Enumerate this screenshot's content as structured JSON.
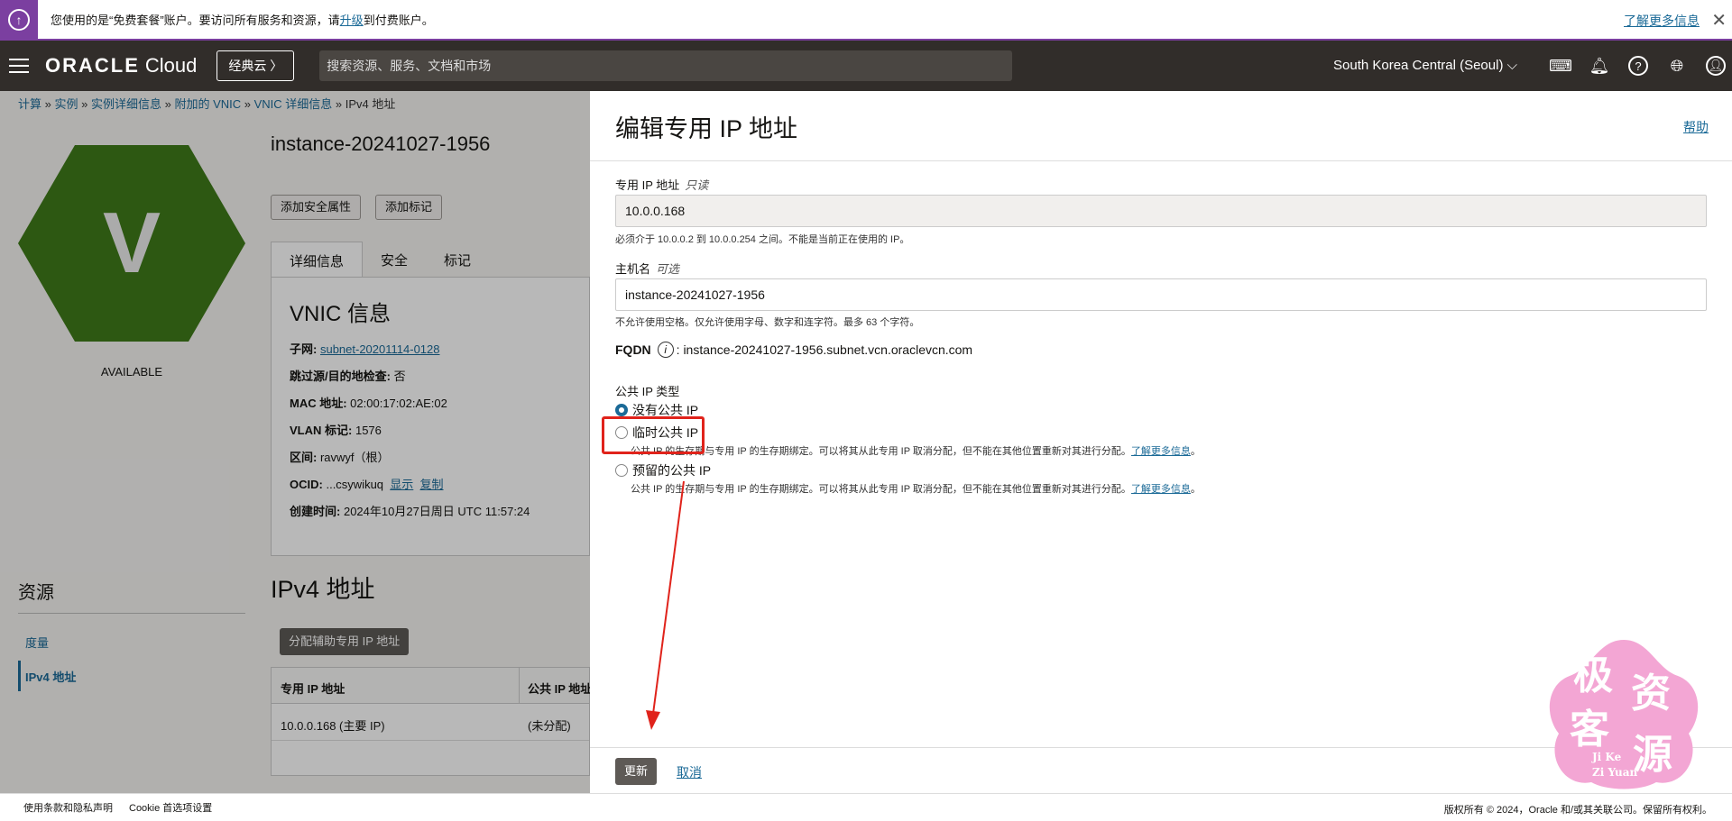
{
  "announcement": {
    "text_before": "您使用的是“免费套餐”账户。要访问所有服务和资源，请",
    "upgrade_link": "升级",
    "text_after": "到付费账户。",
    "learn_more": "了解更多信息"
  },
  "header": {
    "logo_oracle": "ORACLE",
    "logo_cloud": "Cloud",
    "classic_button": "经典云 〉",
    "search_placeholder": "搜索资源、服务、文档和市场",
    "region": "South Korea Central (Seoul)"
  },
  "breadcrumb": [
    "计算",
    "实例",
    "实例详细信息",
    "附加的 VNIC",
    "VNIC 详细信息",
    "IPv4 地址"
  ],
  "instance": {
    "badge_letter": "V",
    "status": "AVAILABLE",
    "name": "instance-20241027-1956",
    "btn_add_security": "添加安全属性",
    "btn_add_tags": "添加标记"
  },
  "tabs": [
    "详细信息",
    "安全",
    "标记"
  ],
  "vnic_info": {
    "title": "VNIC 信息",
    "subnet_label": "子网:",
    "subnet_value": "subnet-20201114-0128",
    "skip_check_label": "跳过源/目的地检查:",
    "skip_check_value": "否",
    "mac_label": "MAC 地址:",
    "mac_value": "02:00:17:02:AE:02",
    "vlan_label": "VLAN 标记:",
    "vlan_value": "1576",
    "zone_label": "区间:",
    "zone_value": "ravwyf（根）",
    "ocid_label": "OCID:",
    "ocid_value": "...csywikuq",
    "ocid_show": "显示",
    "ocid_copy": "复制",
    "created_label": "创建时间:",
    "created_value": "2024年10月27日周日 UTC 11:57:24"
  },
  "resources": {
    "title": "资源",
    "items": [
      "度量",
      "IPv4 地址"
    ]
  },
  "ipv4": {
    "title": "IPv4 地址",
    "assign_button": "分配辅助专用 IP 地址",
    "col_private": "专用 IP 地址",
    "col_public": "公共 IP 地址",
    "row_private": "10.0.0.168 (主要 IP)",
    "row_public": "(未分配)"
  },
  "edit_panel": {
    "title": "编辑专用 IP 地址",
    "help": "帮助",
    "private_ip_label": "专用 IP 地址",
    "private_ip_tag": "只读",
    "private_ip_value": "10.0.0.168",
    "private_ip_hint": "必须介于 10.0.0.2 到 10.0.0.254 之间。不能是当前正在使用的 IP。",
    "hostname_label": "主机名",
    "hostname_tag": "可选",
    "hostname_value": "instance-20241027-1956",
    "hostname_hint": "不允许使用空格。仅允许使用字母、数字和连字符。最多 63 个字符。",
    "fqdn_label": "FQDN",
    "fqdn_value": ": instance-20241027-1956.subnet.vcn.oraclevcn.com",
    "public_ip_type_label": "公共 IP 类型",
    "option_none": "没有公共 IP",
    "option_ephemeral": "临时公共 IP",
    "option_ephemeral_desc": "公共 IP 的生存期与专用 IP 的生存期绑定。可以将其从此专用 IP 取消分配，但不能在其他位置重新对其进行分配。",
    "option_reserved": "预留的公共 IP",
    "option_reserved_desc": "公共 IP 的生存期与专用 IP 的生存期绑定。可以将其从此专用 IP 取消分配，但不能在其他位置重新对其进行分配。",
    "learn_more": "了解更多信息",
    "update_button": "更新",
    "cancel_link": "取消"
  },
  "footer": {
    "terms": "使用条款和隐私声明",
    "cookie": "Cookie 首选项设置",
    "copyright": "版权所有 © 2024，Oracle 和/或其关联公司。保留所有权利。"
  },
  "watermark": {
    "chars": [
      "极",
      "资",
      "客",
      "源"
    ],
    "latin_line1": "Ji Ke",
    "latin_line2": "Zi Yuan"
  },
  "colors": {
    "accent_purple": "#7b3fa0",
    "header_bg": "#312d2a",
    "link_blue": "#1b6a97",
    "instance_green": "#3f7a19",
    "annotation_red": "#e0231b",
    "watermark_pink": "#f3a6d4"
  }
}
